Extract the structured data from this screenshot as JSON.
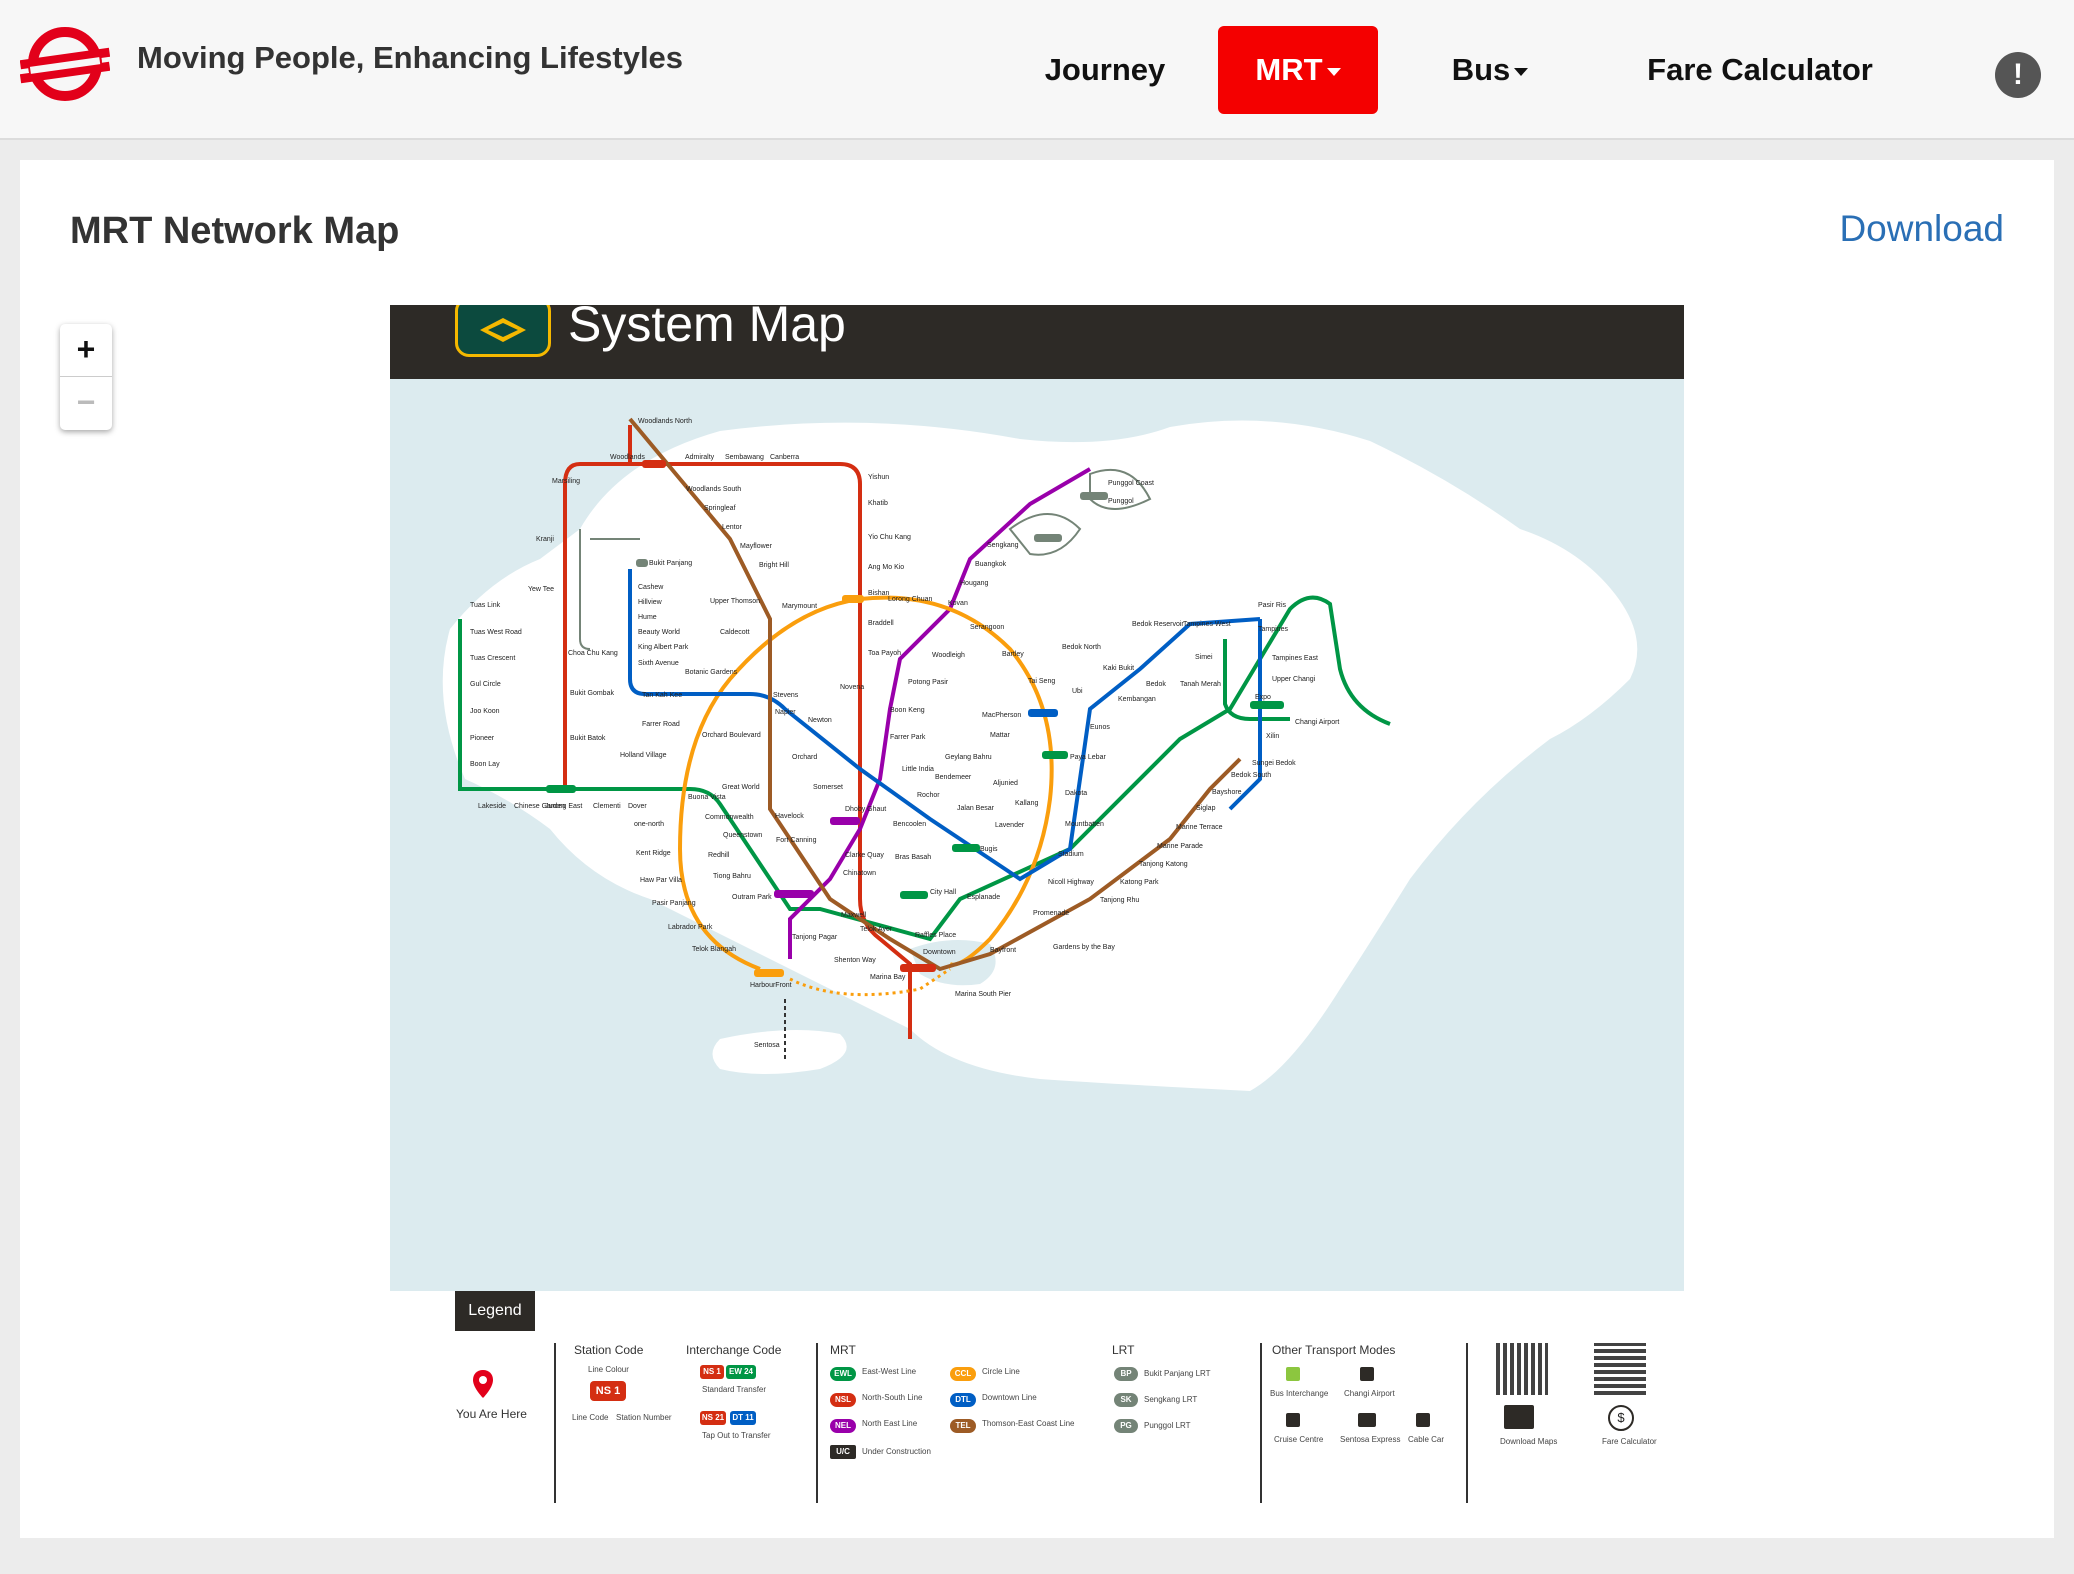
{
  "header": {
    "tagline": "Moving People, Enhancing Lifestyles",
    "nav": {
      "journey": "Journey",
      "mrt": "MRT",
      "bus": "Bus",
      "fare_calculator": "Fare Calculator"
    },
    "alert_icon": "!"
  },
  "main": {
    "title": "MRT Network Map",
    "download": "Download",
    "zoom_in": "+",
    "zoom_out": "−"
  },
  "map": {
    "title": "System Map",
    "stations": {
      "woodlands_north": "Woodlands North",
      "woodlands": "Woodlands",
      "admiralty": "Admiralty",
      "sembawang": "Sembawang",
      "canberra": "Canberra",
      "yishun": "Yishun",
      "khatib": "Khatib",
      "yio_chu_kang": "Yio Chu Kang",
      "ang_mo_kio": "Ang Mo Kio",
      "bishan": "Bishan",
      "braddell": "Braddell",
      "toa_payoh": "Toa Payoh",
      "novena": "Novena",
      "newton": "Newton",
      "orchard": "Orchard",
      "somerset": "Somerset",
      "dhoby_ghaut": "Dhoby Ghaut",
      "city_hall": "City Hall",
      "raffles_place": "Raffles Place",
      "marina_bay": "Marina Bay",
      "marina_south_pier": "Marina South Pier",
      "marsiling": "Marsiling",
      "kranji": "Kranji",
      "yew_tee": "Yew Tee",
      "choa_chu_kang": "Choa Chu Kang",
      "bukit_gombak": "Bukit Gombak",
      "bukit_batok": "Bukit Batok",
      "jurong_east": "Jurong East",
      "tuas_link": "Tuas Link",
      "tuas_west_road": "Tuas West Road",
      "tuas_crescent": "Tuas Crescent",
      "gul_circle": "Gul Circle",
      "joo_koon": "Joo Koon",
      "pioneer": "Pioneer",
      "boon_lay": "Boon Lay",
      "lakeside": "Lakeside",
      "chinese_garden": "Chinese Garden",
      "clementi": "Clementi",
      "dover": "Dover",
      "buona_vista": "Buona Vista",
      "commonwealth": "Commonwealth",
      "queenstown": "Queenstown",
      "redhill": "Redhill",
      "tiong_bahru": "Tiong Bahru",
      "outram_park": "Outram Park",
      "tanjong_pagar": "Tanjong Pagar",
      "bugis": "Bugis",
      "lavender": "Lavender",
      "kallang": "Kallang",
      "aljunied": "Aljunied",
      "paya_lebar": "Paya Lebar",
      "eunos": "Eunos",
      "kembangan": "Kembangan",
      "bedok": "Bedok",
      "tanah_merah": "Tanah Merah",
      "simei": "Simei",
      "tampines": "Tampines",
      "pasir_ris": "Pasir Ris",
      "expo": "Expo",
      "changi_airport": "Changi Airport",
      "harbourfront": "HarbourFront",
      "telok_blangah": "Telok Blangah",
      "labrador_park": "Labrador Park",
      "pasir_panjang": "Pasir Panjang",
      "haw_par_villa": "Haw Par Villa",
      "kent_ridge": "Kent Ridge",
      "one_north": "one-north",
      "holland_village": "Holland Village",
      "farrer_road": "Farrer Road",
      "botanic_gardens": "Botanic Gardens",
      "caldecott": "Caldecott",
      "marymount": "Marymount",
      "lorong_chuan": "Lorong Chuan",
      "serangoon": "Serangoon",
      "bartley": "Bartley",
      "tai_seng": "Tai Seng",
      "macpherson": "MacPherson",
      "dakota": "Dakota",
      "mountbatten": "Mountbatten",
      "stadium": "Stadium",
      "nicoll_highway": "Nicoll Highway",
      "promenade": "Promenade",
      "esplanade": "Esplanade",
      "bras_basah": "Bras Basah",
      "bayfront": "Bayfront",
      "gardens_by_the_bay": "Gardens by the Bay",
      "punggol": "Punggol",
      "punggol_coast": "Punggol Coast",
      "sengkang": "Sengkang",
      "buangkok": "Buangkok",
      "hougang": "Hougang",
      "kovan": "Kovan",
      "woodleigh": "Woodleigh",
      "potong_pasir": "Potong Pasir",
      "boon_keng": "Boon Keng",
      "farrer_park": "Farrer Park",
      "little_india": "Little India",
      "clarke_quay": "Clarke Quay",
      "chinatown": "Chinatown",
      "bukit_panjang": "Bukit Panjang",
      "cashew": "Cashew",
      "hillview": "Hillview",
      "hume": "Hume",
      "beauty_world": "Beauty World",
      "king_albert_park": "King Albert Park",
      "sixth_avenue": "Sixth Avenue",
      "tan_kah_kee": "Tan Kah Kee",
      "stevens": "Stevens",
      "rochor": "Rochor",
      "jalan_besar": "Jalan Besar",
      "bencoolen": "Bencoolen",
      "fort_canning": "Fort Canning",
      "telok_ayer": "Telok Ayer",
      "downtown": "Downtown",
      "bedok_north": "Bedok North",
      "bedok_reservoir": "Bedok Reservoir",
      "tampines_west": "Tampines West",
      "tampines_east": "Tampines East",
      "upper_changi": "Upper Changi",
      "kaki_bukit": "Kaki Bukit",
      "ubi": "Ubi",
      "mattar": "Mattar",
      "geylang_bahru": "Geylang Bahru",
      "bendemeer": "Bendemeer",
      "xilin": "Xilin",
      "sungei_bedok": "Sungei Bedok",
      "bedok_south": "Bedok South",
      "bayshore": "Bayshore",
      "siglap": "Siglap",
      "marine_terrace": "Marine Terrace",
      "marine_parade": "Marine Parade",
      "tanjong_katong": "Tanjong Katong",
      "katong_park": "Katong Park",
      "tanjong_rhu": "Tanjong Rhu",
      "woodlands_south": "Woodlands South",
      "springleaf": "Springleaf",
      "lentor": "Lentor",
      "mayflower": "Mayflower",
      "bright_hill": "Bright Hill",
      "upper_thomson": "Upper Thomson",
      "napier": "Napier",
      "orchard_boulevard": "Orchard Boulevard",
      "great_world": "Great World",
      "havelock": "Havelock",
      "maxwell": "Maxwell",
      "shenton_way": "Shenton Way",
      "sentosa": "Sentosa"
    },
    "legend": {
      "title": "Legend",
      "you_are_here": "You Are Here",
      "station_code": "Station Code",
      "line_colour": "Line Colour",
      "line_code": "Line Code",
      "station_number": "Station Number",
      "ns1": "NS 1",
      "interchange_code": "Interchange Code",
      "ew24": "EW 24",
      "standard_transfer": "Standard Transfer",
      "ns21": "NS 21",
      "dt11": "DT 11",
      "tap_out": "Tap Out to Transfer",
      "mrt": "MRT",
      "ewl": "EWL",
      "ewl_name": "East-West Line",
      "nsl": "NSL",
      "nsl_name": "North-South Line",
      "nel": "NEL",
      "nel_name": "North East Line",
      "ccl": "CCL",
      "ccl_name": "Circle Line",
      "dtl": "DTL",
      "dtl_name": "Downtown Line",
      "tel": "TEL",
      "tel_name": "Thomson-East Coast Line",
      "uc": "U/C",
      "under_construction": "Under Construction",
      "lrt": "LRT",
      "bp": "BP",
      "bp_name": "Bukit Panjang LRT",
      "sk": "SK",
      "sk_name": "Sengkang LRT",
      "pg": "PG",
      "pg_name": "Punggol LRT",
      "other_modes": "Other Transport Modes",
      "bus_interchange": "Bus Interchange",
      "changi_airport": "Changi Airport",
      "cruise_centre": "Cruise Centre",
      "sentosa_express": "Sentosa Express",
      "cable_car": "Cable Car",
      "download_maps": "Download Maps",
      "fare_calculator": "Fare Calculator"
    },
    "colors": {
      "ewl": "#009645",
      "nsl": "#d42e12",
      "nel": "#9900aa",
      "ccl": "#fa9e0d",
      "dtl": "#005ec4",
      "tel": "#9d5b25",
      "lrt": "#748477",
      "brand_red": "#e2001a"
    }
  }
}
